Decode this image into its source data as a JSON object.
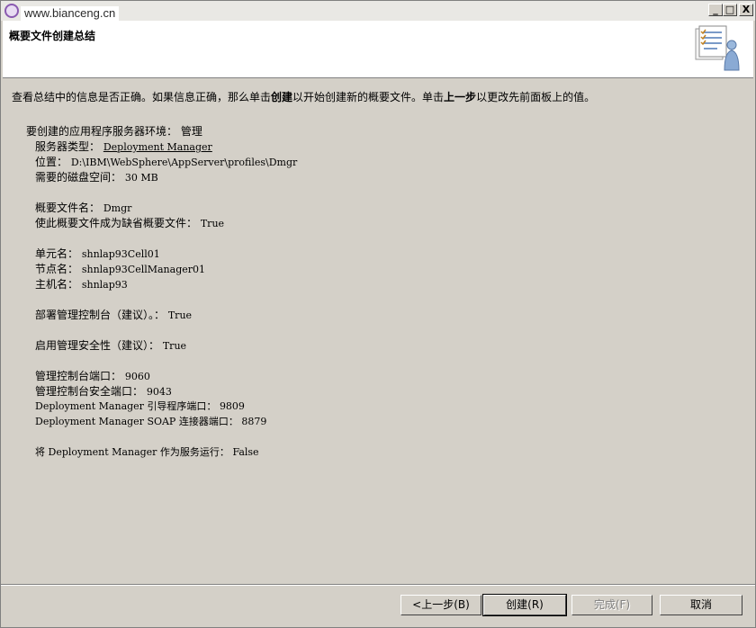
{
  "titlebar": {
    "watermark": "www.bianceng.cn",
    "min": "_",
    "max": "□",
    "close": "X"
  },
  "header": {
    "title": "概要文件创建总结"
  },
  "instruction": {
    "before": "查看总结中的信息是否正确。如果信息正确，那么单击",
    "create_word": "创建",
    "middle": "以开始创建新的概要文件。单击",
    "back_word": "上一步",
    "after": "以更改先前面板上的值。"
  },
  "summary": {
    "env_label": "要创建的应用程序服务器环境：",
    "env_value": "管理",
    "server_type_label": "服务器类型：",
    "server_type_value": "Deployment Manager",
    "location_label": "位置：",
    "location_value": "D:\\IBM\\WebSphere\\AppServer\\profiles\\Dmgr",
    "disk_label": "需要的磁盘空间：",
    "disk_value": "30 MB",
    "profile_name_label": "概要文件名：",
    "profile_name_value": "Dmgr",
    "default_label": "使此概要文件成为缺省概要文件：",
    "default_value": "True",
    "cell_label": "单元名：",
    "cell_value": "shnlap93Cell01",
    "node_label": "节点名：",
    "node_value": "shnlap93CellManager01",
    "host_label": "主机名：",
    "host_value": "shnlap93",
    "deploy_console_label": "部署管理控制台（建议）。：",
    "deploy_console_value": "True",
    "security_label": "启用管理安全性（建议）：",
    "security_value": "True",
    "console_port_label": "管理控制台端口：",
    "console_port_value": "9060",
    "console_secure_port_label": "管理控制台安全端口：",
    "console_secure_port_value": "9043",
    "bootstrap_label": "Deployment Manager 引导程序端口：",
    "bootstrap_value": "9809",
    "soap_label": "Deployment Manager SOAP 连接器端口：",
    "soap_value": "8879",
    "service_label": "将 Deployment Manager 作为服务运行：",
    "service_value": "False"
  },
  "buttons": {
    "back": "<上一步(B)",
    "create": "创建(R)",
    "finish": "完成(F)",
    "cancel": "取消"
  }
}
